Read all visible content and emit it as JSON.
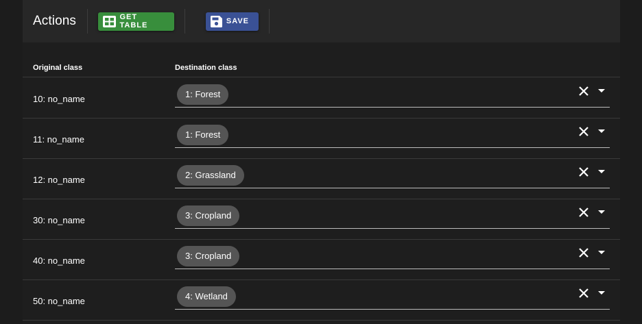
{
  "toolbar": {
    "title": "Actions",
    "get_table_label": "GET TABLE",
    "save_label": "SAVE"
  },
  "table": {
    "headers": {
      "original": "Original class",
      "destination": "Destination class"
    },
    "rows": [
      {
        "original": "10: no_name",
        "destination": "1: Forest"
      },
      {
        "original": "11: no_name",
        "destination": "1: Forest"
      },
      {
        "original": "12: no_name",
        "destination": "2: Grassland"
      },
      {
        "original": "30: no_name",
        "destination": "3: Cropland"
      },
      {
        "original": "40: no_name",
        "destination": "3: Cropland"
      },
      {
        "original": "50: no_name",
        "destination": "4: Wetland"
      }
    ]
  },
  "icons": {
    "get_table": "table-icon",
    "save": "floppy-disk-icon",
    "clear": "close-icon",
    "dropdown": "caret-down-icon"
  },
  "colors": {
    "background": "#1c1c1c",
    "toolbar": "#272727",
    "get_table_button": "#388e3c",
    "save_button": "#3a5195",
    "chip": "#555555"
  }
}
